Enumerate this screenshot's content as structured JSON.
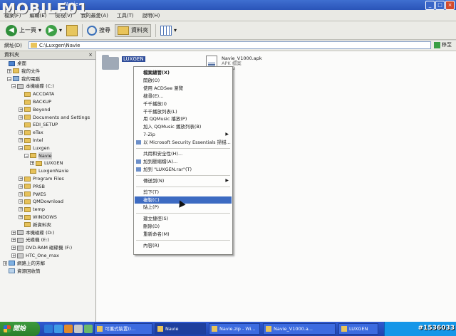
{
  "watermark": {
    "logo": "MOBILE01",
    "id": "#1536033"
  },
  "window": {
    "title": "Navie"
  },
  "menubar": [
    "檔案(F)",
    "編輯(E)",
    "檢視(V)",
    "我的最愛(A)",
    "工具(T)",
    "說明(H)"
  ],
  "toolbar": {
    "back": "上一頁",
    "search": "搜尋",
    "folders": "資料夾"
  },
  "address": {
    "label": "網址(D)",
    "path": "C:\\Luxgen\\Navie",
    "go": "移至"
  },
  "leftpane": {
    "header": "資料夾",
    "close": "×"
  },
  "tree": [
    {
      "label": "桌面",
      "icon": "desk",
      "pm": ""
    },
    {
      "label": "我的文件",
      "icon": "folder",
      "pm": "+"
    },
    {
      "label": "我的電腦",
      "icon": "pc",
      "pm": "−"
    },
    {
      "label": "本機磁碟 (C:)",
      "icon": "drv",
      "pm": "−"
    },
    {
      "label": "ACCDATA",
      "icon": "folder",
      "pm": ""
    },
    {
      "label": "BACKUP",
      "icon": "folder",
      "pm": ""
    },
    {
      "label": "Beyond",
      "icon": "folder",
      "pm": "+"
    },
    {
      "label": "Documents and Settings",
      "icon": "folder",
      "pm": "+"
    },
    {
      "label": "EDI_SETUP",
      "icon": "folder",
      "pm": ""
    },
    {
      "label": "eTax",
      "icon": "folder",
      "pm": "+"
    },
    {
      "label": "Intel",
      "icon": "folder",
      "pm": "+"
    },
    {
      "label": "Luxgen",
      "icon": "folder",
      "pm": "−"
    },
    {
      "label": "Navie",
      "icon": "folder",
      "pm": "−",
      "selected": true
    },
    {
      "label": "LUXGEN",
      "icon": "folder",
      "pm": "+"
    },
    {
      "label": "LuxgenNavie",
      "icon": "folder",
      "pm": ""
    },
    {
      "label": "Program Files",
      "icon": "folder",
      "pm": "+"
    },
    {
      "label": "PRSB",
      "icon": "folder",
      "pm": "+"
    },
    {
      "label": "PWES",
      "icon": "folder",
      "pm": "+"
    },
    {
      "label": "QMDownload",
      "icon": "folder",
      "pm": "+"
    },
    {
      "label": "temp",
      "icon": "folder",
      "pm": "+"
    },
    {
      "label": "WINDOWS",
      "icon": "folder",
      "pm": "+"
    },
    {
      "label": "新資料夾",
      "icon": "folder",
      "pm": ""
    },
    {
      "label": "本機磁碟 (D:)",
      "icon": "drv",
      "pm": "+"
    },
    {
      "label": "光碟機 (E:)",
      "icon": "drv",
      "pm": "+"
    },
    {
      "label": "DVD-RAM 磁碟機 (F:)",
      "icon": "drv",
      "pm": "+"
    },
    {
      "label": "HTC_One_max",
      "icon": "drv",
      "pm": "+"
    },
    {
      "label": "網路上的芳鄰",
      "icon": "net",
      "pm": "+"
    },
    {
      "label": "資源回收筒",
      "icon": "bin",
      "pm": ""
    }
  ],
  "files": {
    "folder": {
      "name": "LUXGEN"
    },
    "apk": {
      "name": "Navie_V1000.apk",
      "type": "APK 檔案",
      "size": "75 KB"
    }
  },
  "context_menu": [
    {
      "label": "檔案總管(X)",
      "bold": true
    },
    {
      "label": "開啟(O)"
    },
    {
      "label": "使用 ACDSee 瀏覽"
    },
    {
      "label": "搜尋(E)..."
    },
    {
      "label": "千千播放(I)"
    },
    {
      "label": "千千播放列表(L)"
    },
    {
      "label": "用 QQMusic 播放(P)"
    },
    {
      "label": "加入 QQMusic 播放列表(B)"
    },
    {
      "label": "7-Zip",
      "submenu": true
    },
    {
      "label": "以 Microsoft Security Essentials 掃描...",
      "icon": true
    },
    {
      "sep": true
    },
    {
      "label": "共用和安全性(H)..."
    },
    {
      "label": "加到壓縮檔(A)...",
      "icon": true
    },
    {
      "label": "加到 \"LUXGEN.rar\"(T)",
      "icon": true
    },
    {
      "sep": true
    },
    {
      "label": "傳送到(N)",
      "submenu": true
    },
    {
      "sep": true
    },
    {
      "label": "剪下(T)"
    },
    {
      "label": "複製(C)",
      "highlight": true
    },
    {
      "label": "貼上(P)"
    },
    {
      "sep": true
    },
    {
      "label": "建立捷徑(S)"
    },
    {
      "label": "刪除(D)"
    },
    {
      "label": "重新命名(M)"
    },
    {
      "sep": true
    },
    {
      "label": "內容(R)"
    }
  ],
  "taskbar": {
    "start": "開始",
    "tasks": [
      "可攜式裝置(I...",
      "Navie",
      "Navie.zip - Wi...",
      "Navie_V1000.a...",
      "LUXGEN"
    ]
  }
}
